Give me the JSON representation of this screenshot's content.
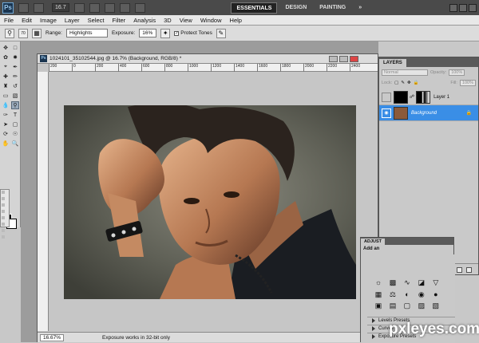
{
  "app": {
    "logo": "Ps",
    "zoom": "16.7",
    "workspaces": [
      "ESSENTIALS",
      "DESIGN",
      "PAINTING",
      "»"
    ],
    "active_workspace": "ESSENTIALS"
  },
  "menu": [
    "File",
    "Edit",
    "Image",
    "Layer",
    "Select",
    "Filter",
    "Analysis",
    "3D",
    "View",
    "Window",
    "Help"
  ],
  "options": {
    "brush_size": "70",
    "range_label": "Range:",
    "range_value": "Highlights",
    "exposure_label": "Exposure:",
    "exposure_value": "16%",
    "protect_tones_label": "Protect Tones",
    "protect_tones_checked": true
  },
  "document": {
    "title": "1024101_35102544.jpg @ 16.7% (Background, RGB/8) *",
    "ruler_ticks": [
      "200",
      "0",
      "200",
      "400",
      "600",
      "800",
      "1000",
      "1200",
      "1400",
      "1600",
      "1800",
      "2000",
      "2200",
      "2400"
    ],
    "zoom_field": "16.67%",
    "status_message": "Exposure works in 32-bit only"
  },
  "layers_panel": {
    "tab": "LAYERS",
    "blend_mode": "Normal",
    "opacity_label": "Opacity:",
    "opacity_value": "100%",
    "lock_label": "Lock:",
    "fill_label": "Fill:",
    "fill_value": "100%",
    "layers": [
      {
        "name": "Layer 1",
        "selected": false
      },
      {
        "name": "Background",
        "selected": true
      }
    ]
  },
  "adjustments_panel": {
    "tab": "ADJUST",
    "subtitle": "Add an",
    "presets": [
      "Levels Presets",
      "Curves",
      "Exposure Presets"
    ]
  },
  "watermark": "pxleyes.com",
  "colors": {
    "accent": "#3a8ee6",
    "titlebar": "#4a4a4a",
    "canvas": "#9c9c9c"
  }
}
